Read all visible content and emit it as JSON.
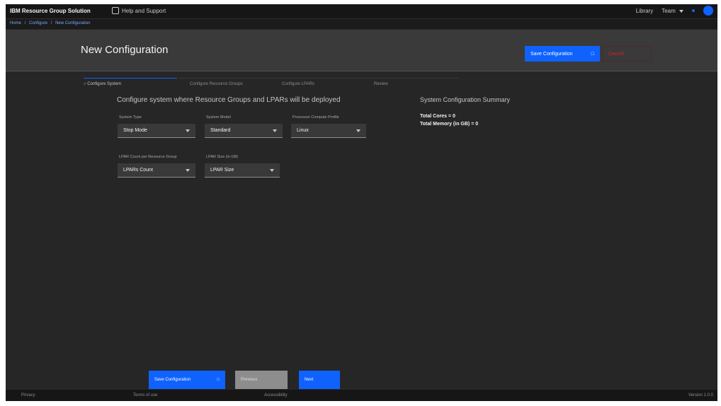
{
  "topbar": {
    "app_name": "IBM Resource Group Solution",
    "help_link": "Help and Support",
    "right_items": [
      "Library",
      "Team"
    ]
  },
  "breadcrumb": [
    "Home",
    "/",
    "Configure",
    "/",
    "New Configuration"
  ],
  "header": {
    "title": "New Configuration",
    "primary_button": "Save Configuration",
    "danger_button": "Cancel"
  },
  "steps": [
    {
      "label": "Configure System"
    },
    {
      "label": "Configure Resource Groups"
    },
    {
      "label": "Configure LPARs"
    },
    {
      "label": "Review"
    }
  ],
  "form": {
    "title": "Configure system where Resource Groups and LPARs will be deployed",
    "fields": [
      {
        "label": "System Type",
        "value": "Stop Mode"
      },
      {
        "label": "System Model",
        "value": "Standard"
      },
      {
        "label": "Processor Compute Profile",
        "value": "Linux"
      },
      {
        "label": "LPAR Count per Resource Group",
        "value": "LPARs Count"
      },
      {
        "label": "LPAR Size (in GB)",
        "value": "LPAR Size"
      }
    ]
  },
  "summary": {
    "title": "System Configuration Summary",
    "lines": [
      "Total Cores = 0",
      "Total Memory (in GB) = 0"
    ]
  },
  "actions": {
    "save": "Save Configuration",
    "previous": "Previous",
    "next": "Next"
  },
  "footer": {
    "left": "Privacy",
    "terms": "Terms of use",
    "accessibility": "Accessibility",
    "version": "Version 1.0.0"
  },
  "colors": {
    "primary": "#0f62fe",
    "danger": "#da1e28",
    "background": "#262626",
    "header": "#3a3a3a"
  }
}
